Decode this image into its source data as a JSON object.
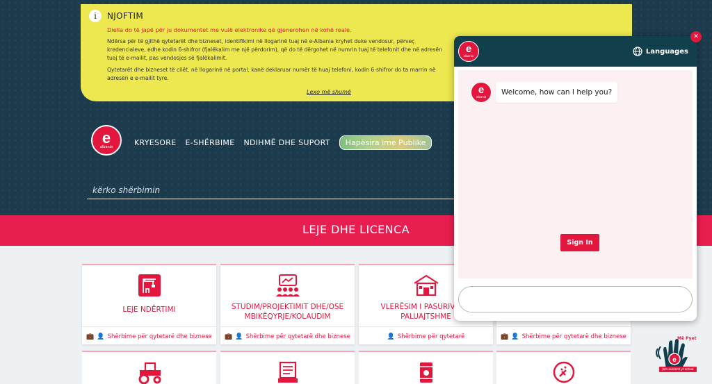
{
  "notice": {
    "icon": "info-icon",
    "title": "NJOFTIM",
    "highlight": "Diella do të japë për ju dokumentet me vulë elektronike që gjenerohen në kohë reale.",
    "paragraph1": "Ndërsa për të gjithë qytetarët dhe bizneset, identifikimi në llogarinë tuaj në e-Albania kryhet duke vendosur, përveç kredencialeve, edhe kodin 6-shifror (fjalëkalim me një përdorim), që do të dërgohet në numrin tuaj të telefonit dhe në adresën tuaj të e-mailit, pas vendosjes së fjalëkalimit.",
    "paragraph2": "Qytetarët dhe bizneset të cilët, në llogarinë në portal, kanë deklaruar numër të huaj telefoni, kodin 6-shifror do ta marrin në adresën e e-mailit tyre.",
    "read_more": "Lexo më shumë"
  },
  "brand": {
    "logo_letter": "e",
    "logo_sub": "albania"
  },
  "nav": {
    "items": [
      "KRYESORE",
      "E-SHËRBIME",
      "NDIHMË DHE SUPORT"
    ],
    "public_space": "Hapësira ime Publike"
  },
  "search": {
    "placeholder": "kërko shërbimin"
  },
  "section": {
    "title": "LEJE DHE LICENCA"
  },
  "cards": [
    {
      "title": "LEJE NDËRTIMI",
      "footer": "Shërbime për qytetarë dhe biznese",
      "icon": "crane-icon"
    },
    {
      "title": "STUDIM/PROJEKTIMIT DHE/OSE MBIKËQYRJE/KOLAUDIM",
      "footer": "Shërbime për qytetarë dhe biznese",
      "icon": "meeting-icon"
    },
    {
      "title": "VLERËSIM I PASURIVE TË PALUAJTSHME",
      "footer": "Shërbime për qytetarë",
      "icon": "building-icon"
    },
    {
      "title": "",
      "footer": "Shërbime për qytetarë dhe biznese",
      "icon": "briefcase-icon"
    }
  ],
  "bottom_cards": [
    {
      "icon": "tractor-icon"
    },
    {
      "icon": "document-icon"
    },
    {
      "icon": "hazard-barrel-icon"
    },
    {
      "icon": "plug-icon"
    }
  ],
  "chat": {
    "languages_label": "Languages",
    "welcome": "Welcome, how can I help you?",
    "sign_in": "Sign In",
    "input_value": ""
  },
  "assistant": {
    "label_top": "Më Pyet",
    "label_bottom": "Jam asistenti yt virtual"
  },
  "colors": {
    "brand_red": "#e3173e",
    "navy": "#1c3b4d",
    "notice_yellow": "#ede84f"
  }
}
